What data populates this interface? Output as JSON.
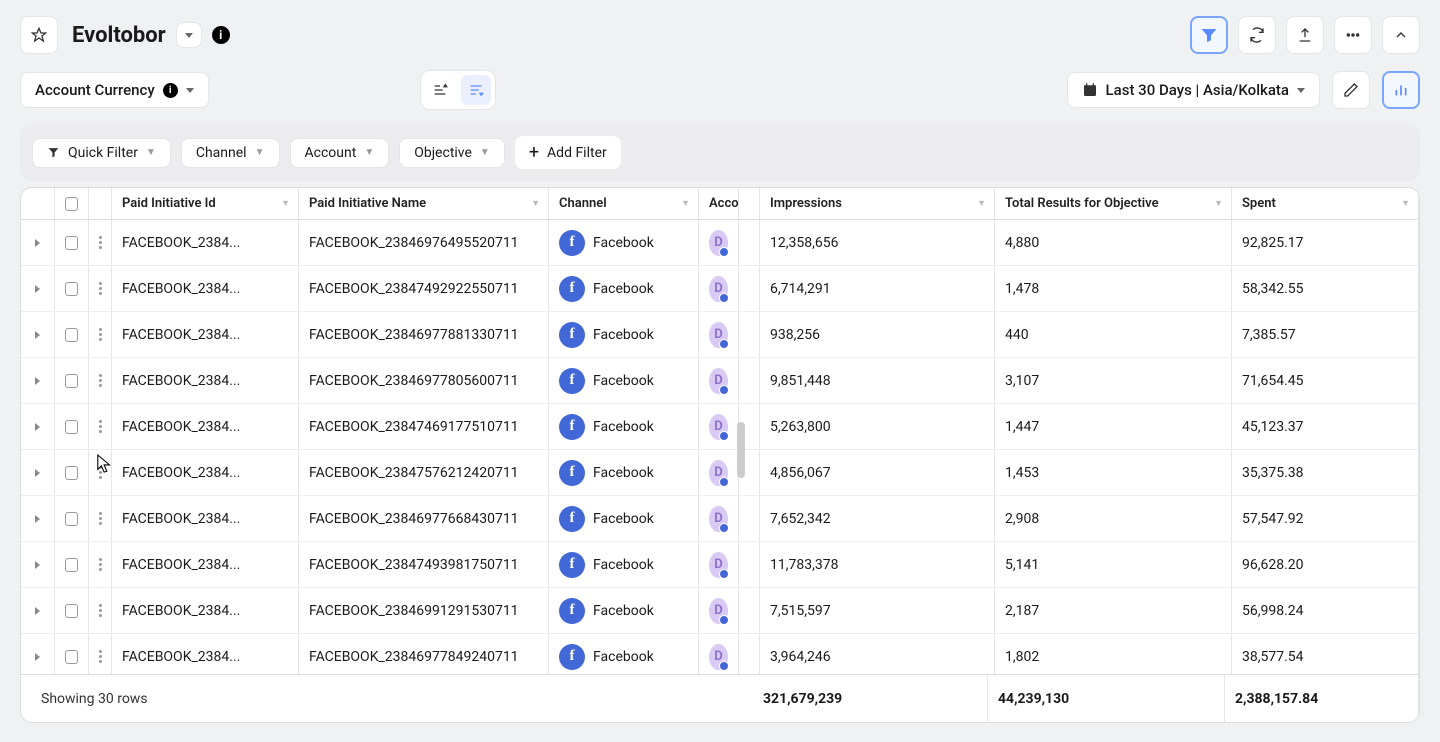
{
  "header": {
    "title": "Evoltobor"
  },
  "toolbar": {
    "account_currency": "Account Currency",
    "date_range": "Last 30 Days | Asia/Kolkata"
  },
  "filters": {
    "quick": "Quick Filter",
    "channel": "Channel",
    "account": "Account",
    "objective": "Objective",
    "add": "Add Filter"
  },
  "columns": {
    "id": "Paid Initiative Id",
    "name": "Paid Initiative Name",
    "channel": "Channel",
    "account": "Acco",
    "impressions": "Impressions",
    "results": "Total Results for Objective",
    "spent": "Spent"
  },
  "rows": [
    {
      "id": "FACEBOOK_2384...",
      "name": "FACEBOOK_23846976495520711",
      "channel": "Facebook",
      "impr": "12,358,656",
      "res": "4,880",
      "spent": "92,825.17"
    },
    {
      "id": "FACEBOOK_2384...",
      "name": "FACEBOOK_23847492922550711",
      "channel": "Facebook",
      "impr": "6,714,291",
      "res": "1,478",
      "spent": "58,342.55"
    },
    {
      "id": "FACEBOOK_2384...",
      "name": "FACEBOOK_23846977881330711",
      "channel": "Facebook",
      "impr": "938,256",
      "res": "440",
      "spent": "7,385.57"
    },
    {
      "id": "FACEBOOK_2384...",
      "name": "FACEBOOK_23846977805600711",
      "channel": "Facebook",
      "impr": "9,851,448",
      "res": "3,107",
      "spent": "71,654.45"
    },
    {
      "id": "FACEBOOK_2384...",
      "name": "FACEBOOK_23847469177510711",
      "channel": "Facebook",
      "impr": "5,263,800",
      "res": "1,447",
      "spent": "45,123.37"
    },
    {
      "id": "FACEBOOK_2384...",
      "name": "FACEBOOK_23847576212420711",
      "channel": "Facebook",
      "impr": "4,856,067",
      "res": "1,453",
      "spent": "35,375.38"
    },
    {
      "id": "FACEBOOK_2384...",
      "name": "FACEBOOK_23846977668430711",
      "channel": "Facebook",
      "impr": "7,652,342",
      "res": "2,908",
      "spent": "57,547.92"
    },
    {
      "id": "FACEBOOK_2384...",
      "name": "FACEBOOK_23847493981750711",
      "channel": "Facebook",
      "impr": "11,783,378",
      "res": "5,141",
      "spent": "96,628.20"
    },
    {
      "id": "FACEBOOK_2384...",
      "name": "FACEBOOK_23846991291530711",
      "channel": "Facebook",
      "impr": "7,515,597",
      "res": "2,187",
      "spent": "56,998.24"
    },
    {
      "id": "FACEBOOK_2384...",
      "name": "FACEBOOK_23846977849240711",
      "channel": "Facebook",
      "impr": "3,964,246",
      "res": "1,802",
      "spent": "38,577.54"
    }
  ],
  "footer": {
    "showing": "Showing 30 rows",
    "impr": "321,679,239",
    "res": "44,239,130",
    "spent": "2,388,157.84"
  },
  "account_badge": "D"
}
